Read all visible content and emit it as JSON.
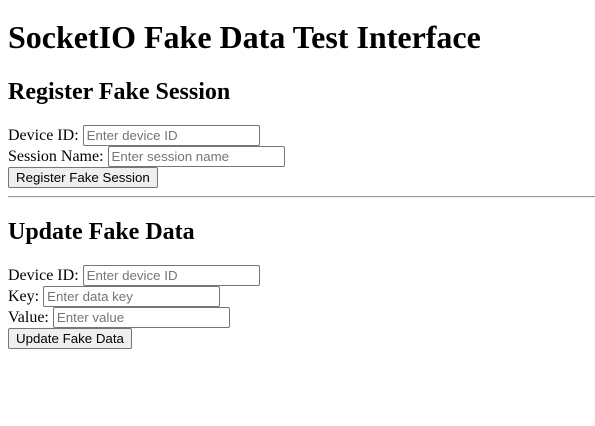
{
  "page": {
    "title": "SocketIO Fake Data Test Interface"
  },
  "register": {
    "heading": "Register Fake Session",
    "device_label": "Device ID:",
    "device_placeholder": "Enter device ID",
    "device_value": "",
    "session_label": "Session Name:",
    "session_placeholder": "Enter session name",
    "session_value": "",
    "button_label": "Register Fake Session"
  },
  "update": {
    "heading": "Update Fake Data",
    "device_label": "Device ID:",
    "device_placeholder": "Enter device ID",
    "device_value": "",
    "key_label": "Key:",
    "key_placeholder": "Enter data key",
    "key_value": "",
    "value_label": "Value:",
    "value_placeholder": "Enter value",
    "value_value": "",
    "button_label": "Update Fake Data"
  }
}
